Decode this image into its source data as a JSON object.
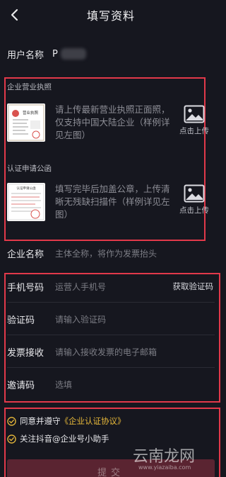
{
  "header": {
    "title": "填写资料"
  },
  "user": {
    "label": "用户名称",
    "value": "P"
  },
  "license": {
    "section_title": "企业营业执照",
    "thumb_title": "营业执照",
    "hint": "请上传最新营业执照正面照，仅支持中国大陆企业（样例详见左图）",
    "upload_label": "点击上传"
  },
  "letter": {
    "section_title": "认证申请公函",
    "thumb_title": "认证申请公函",
    "hint": "填写完毕后加盖公章，上传清晰无残缺扫描件（样例详见左图）",
    "upload_label": "点击上传"
  },
  "company": {
    "label": "企业名称",
    "placeholder": "主体全称，将作为发票抬头"
  },
  "phone": {
    "label": "手机号码",
    "placeholder": "运营人手机号",
    "action": "获取验证码"
  },
  "code": {
    "label": "验证码",
    "placeholder": "请输入验证码"
  },
  "invoice": {
    "label": "发票接收",
    "placeholder": "请输入接收发票的电子邮箱"
  },
  "invite": {
    "label": "邀请码",
    "placeholder": "选填"
  },
  "agreements": {
    "item1_prefix": "同意并遵守",
    "item1_link": "《企业认证协议》",
    "item2": "关注抖音@企业号小助手"
  },
  "submit": {
    "label": "提交"
  },
  "watermark": {
    "main": "云南龙网",
    "url": "www.yiazaiba.com"
  },
  "colors": {
    "accent": "#e8b93a",
    "annotation": "#e2394a",
    "background": "#16171f"
  }
}
